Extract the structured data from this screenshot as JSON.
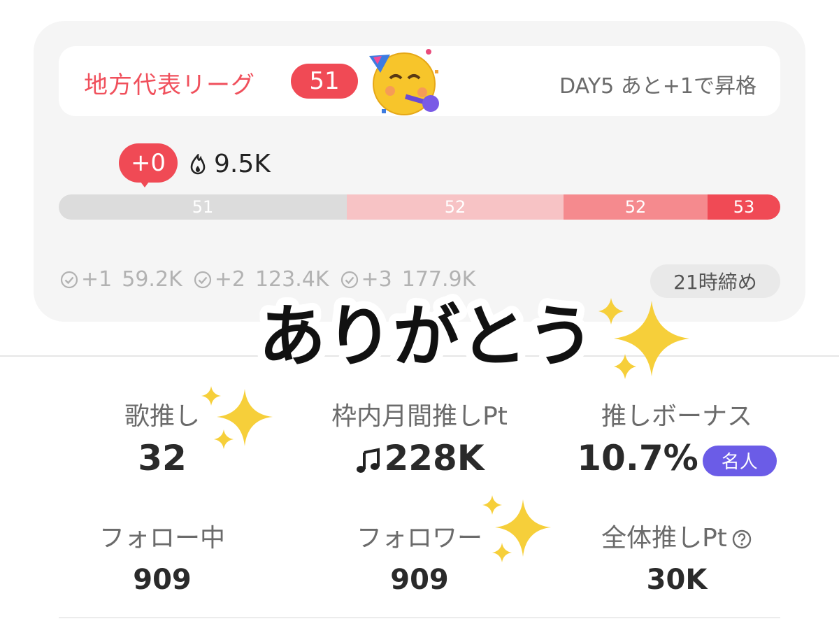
{
  "league": {
    "name": "地方代表リーグ",
    "rank": "51",
    "day_info": "DAY5 あと+1で昇格"
  },
  "progress": {
    "delta": "+0",
    "points": "9.5K",
    "segments": [
      "51",
      "52",
      "52",
      "53"
    ]
  },
  "thresholds": [
    {
      "label": "+1",
      "value": "59.2K"
    },
    {
      "label": "+2",
      "value": "123.4K"
    },
    {
      "label": "+3",
      "value": "177.9K"
    }
  ],
  "deadline": "21時締め",
  "overlay": {
    "text": "ありがとう"
  },
  "stats": {
    "song_oshi": {
      "label": "歌推し",
      "value": "32"
    },
    "monthly_pt": {
      "label": "枠内月間推しPt",
      "value": "228K"
    },
    "bonus": {
      "label": "推しボーナス",
      "value": "10.7%",
      "badge": "名人"
    },
    "following": {
      "label": "フォロー中",
      "value": "909"
    },
    "followers": {
      "label": "フォロワー",
      "value": "909"
    },
    "total_pt": {
      "label": "全体推しPt",
      "value": "30K"
    }
  },
  "colors": {
    "accent_red": "#f04a55",
    "badge_purple": "#6b5ce7",
    "card_bg": "#f5f5f5"
  },
  "icons": [
    "party-face-icon",
    "fire-icon",
    "check-circle-icon",
    "music-note-icon",
    "help-icon",
    "sparkles-icon"
  ]
}
